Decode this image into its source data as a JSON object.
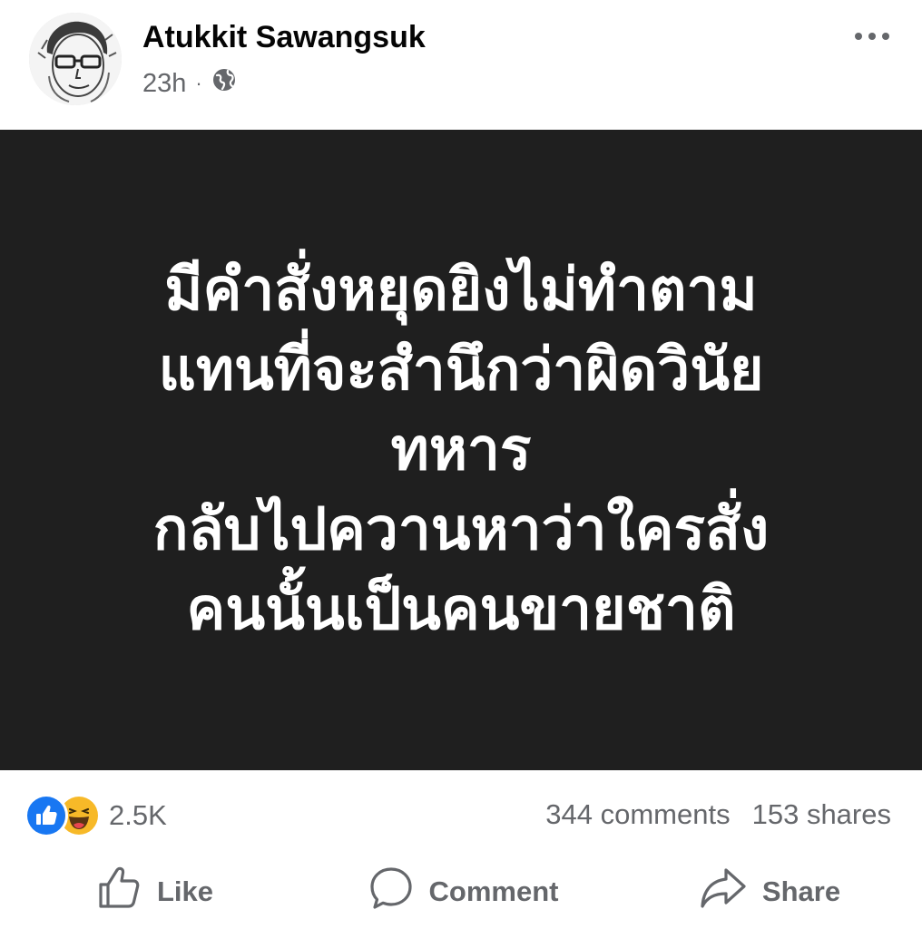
{
  "post": {
    "author": "Atukkit Sawangsuk",
    "timestamp": "23h",
    "separator": "·",
    "audience_icon": "globe-icon",
    "more_icon": "more-horizontal-icon",
    "image_text_lines": [
      "มีคำสั่งหยุดยิงไม่ทำตาม",
      "แทนที่จะสำนึกว่าผิดวินัย",
      "ทหาร",
      "กลับไปควานหาว่าใครสั่ง",
      "คนนั้นเป็นคนขายชาติ"
    ],
    "image_background": "#1f1f1f"
  },
  "stats": {
    "reactions": [
      "like",
      "haha"
    ],
    "reaction_count": "2.5K",
    "comments": "344 comments",
    "shares": "153 shares"
  },
  "actions": {
    "like": "Like",
    "comment": "Comment",
    "share": "Share"
  },
  "colors": {
    "secondary_text": "#65676b",
    "like_blue": "#1877f2",
    "haha_yellow": "#f7b928"
  }
}
